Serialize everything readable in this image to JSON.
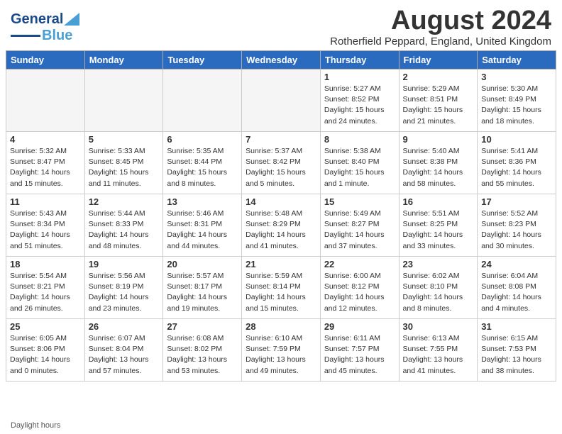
{
  "header": {
    "logo_general": "General",
    "logo_blue": "Blue",
    "month_year": "August 2024",
    "location": "Rotherfield Peppard, England, United Kingdom"
  },
  "days_of_week": [
    "Sunday",
    "Monday",
    "Tuesday",
    "Wednesday",
    "Thursday",
    "Friday",
    "Saturday"
  ],
  "weeks": [
    [
      {
        "day": "",
        "empty": true
      },
      {
        "day": "",
        "empty": true
      },
      {
        "day": "",
        "empty": true
      },
      {
        "day": "",
        "empty": true
      },
      {
        "day": "1",
        "sunrise": "5:27 AM",
        "sunset": "8:52 PM",
        "daylight": "15 hours and 24 minutes."
      },
      {
        "day": "2",
        "sunrise": "5:29 AM",
        "sunset": "8:51 PM",
        "daylight": "15 hours and 21 minutes."
      },
      {
        "day": "3",
        "sunrise": "5:30 AM",
        "sunset": "8:49 PM",
        "daylight": "15 hours and 18 minutes."
      }
    ],
    [
      {
        "day": "4",
        "sunrise": "5:32 AM",
        "sunset": "8:47 PM",
        "daylight": "14 hours and 15 minutes."
      },
      {
        "day": "5",
        "sunrise": "5:33 AM",
        "sunset": "8:45 PM",
        "daylight": "15 hours and 11 minutes."
      },
      {
        "day": "6",
        "sunrise": "5:35 AM",
        "sunset": "8:44 PM",
        "daylight": "15 hours and 8 minutes."
      },
      {
        "day": "7",
        "sunrise": "5:37 AM",
        "sunset": "8:42 PM",
        "daylight": "15 hours and 5 minutes."
      },
      {
        "day": "8",
        "sunrise": "5:38 AM",
        "sunset": "8:40 PM",
        "daylight": "15 hours and 1 minute."
      },
      {
        "day": "9",
        "sunrise": "5:40 AM",
        "sunset": "8:38 PM",
        "daylight": "14 hours and 58 minutes."
      },
      {
        "day": "10",
        "sunrise": "5:41 AM",
        "sunset": "8:36 PM",
        "daylight": "14 hours and 55 minutes."
      }
    ],
    [
      {
        "day": "11",
        "sunrise": "5:43 AM",
        "sunset": "8:34 PM",
        "daylight": "14 hours and 51 minutes."
      },
      {
        "day": "12",
        "sunrise": "5:44 AM",
        "sunset": "8:33 PM",
        "daylight": "14 hours and 48 minutes."
      },
      {
        "day": "13",
        "sunrise": "5:46 AM",
        "sunset": "8:31 PM",
        "daylight": "14 hours and 44 minutes."
      },
      {
        "day": "14",
        "sunrise": "5:48 AM",
        "sunset": "8:29 PM",
        "daylight": "14 hours and 41 minutes."
      },
      {
        "day": "15",
        "sunrise": "5:49 AM",
        "sunset": "8:27 PM",
        "daylight": "14 hours and 37 minutes."
      },
      {
        "day": "16",
        "sunrise": "5:51 AM",
        "sunset": "8:25 PM",
        "daylight": "14 hours and 33 minutes."
      },
      {
        "day": "17",
        "sunrise": "5:52 AM",
        "sunset": "8:23 PM",
        "daylight": "14 hours and 30 minutes."
      }
    ],
    [
      {
        "day": "18",
        "sunrise": "5:54 AM",
        "sunset": "8:21 PM",
        "daylight": "14 hours and 26 minutes."
      },
      {
        "day": "19",
        "sunrise": "5:56 AM",
        "sunset": "8:19 PM",
        "daylight": "14 hours and 23 minutes."
      },
      {
        "day": "20",
        "sunrise": "5:57 AM",
        "sunset": "8:17 PM",
        "daylight": "14 hours and 19 minutes."
      },
      {
        "day": "21",
        "sunrise": "5:59 AM",
        "sunset": "8:14 PM",
        "daylight": "14 hours and 15 minutes."
      },
      {
        "day": "22",
        "sunrise": "6:00 AM",
        "sunset": "8:12 PM",
        "daylight": "14 hours and 12 minutes."
      },
      {
        "day": "23",
        "sunrise": "6:02 AM",
        "sunset": "8:10 PM",
        "daylight": "14 hours and 8 minutes."
      },
      {
        "day": "24",
        "sunrise": "6:04 AM",
        "sunset": "8:08 PM",
        "daylight": "14 hours and 4 minutes."
      }
    ],
    [
      {
        "day": "25",
        "sunrise": "6:05 AM",
        "sunset": "8:06 PM",
        "daylight": "14 hours and 0 minutes."
      },
      {
        "day": "26",
        "sunrise": "6:07 AM",
        "sunset": "8:04 PM",
        "daylight": "13 hours and 57 minutes."
      },
      {
        "day": "27",
        "sunrise": "6:08 AM",
        "sunset": "8:02 PM",
        "daylight": "13 hours and 53 minutes."
      },
      {
        "day": "28",
        "sunrise": "6:10 AM",
        "sunset": "7:59 PM",
        "daylight": "13 hours and 49 minutes."
      },
      {
        "day": "29",
        "sunrise": "6:11 AM",
        "sunset": "7:57 PM",
        "daylight": "13 hours and 45 minutes."
      },
      {
        "day": "30",
        "sunrise": "6:13 AM",
        "sunset": "7:55 PM",
        "daylight": "13 hours and 41 minutes."
      },
      {
        "day": "31",
        "sunrise": "6:15 AM",
        "sunset": "7:53 PM",
        "daylight": "13 hours and 38 minutes."
      }
    ]
  ],
  "footer": {
    "daylight_hours_label": "Daylight hours"
  }
}
